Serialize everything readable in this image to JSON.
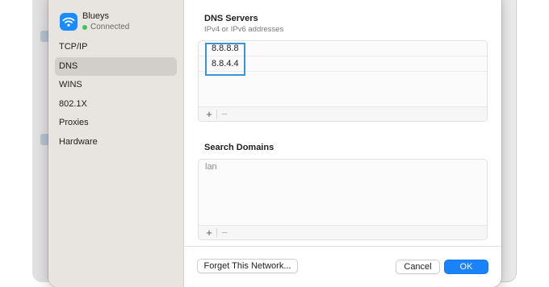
{
  "network": {
    "name": "Blueys",
    "status": "Connected"
  },
  "sidebar": {
    "items": [
      {
        "label": "TCP/IP",
        "selected": false
      },
      {
        "label": "DNS",
        "selected": true
      },
      {
        "label": "WINS",
        "selected": false
      },
      {
        "label": "802.1X",
        "selected": false
      },
      {
        "label": "Proxies",
        "selected": false
      },
      {
        "label": "Hardware",
        "selected": false
      }
    ]
  },
  "dns_servers": {
    "title": "DNS Servers",
    "subtitle": "IPv4 or IPv6 addresses",
    "entries": [
      "8.8.8.8",
      "8.8.4.4"
    ],
    "add_label": "+",
    "remove_label": "−"
  },
  "search_domains": {
    "title": "Search Domains",
    "placeholder": "lan",
    "add_label": "+",
    "remove_label": "−"
  },
  "footer": {
    "forget_label": "Forget This Network...",
    "cancel_label": "Cancel",
    "ok_label": "OK"
  },
  "colors": {
    "accent": "#1a82fb",
    "highlight": "#3a95d8",
    "connected": "#34c759",
    "wifi_badge": "#1a8cff"
  },
  "icons": {
    "network": "wifi-icon",
    "status": "status-dot-icon"
  }
}
